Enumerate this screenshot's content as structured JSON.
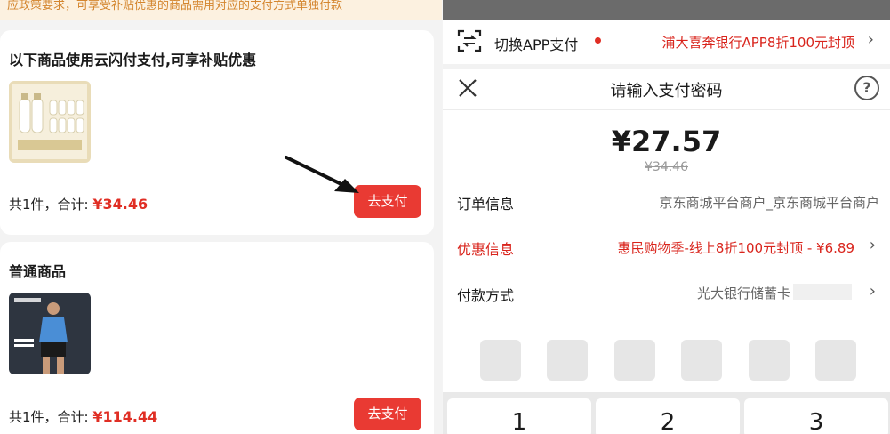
{
  "left": {
    "notice": "应政策要求，可享受补贴优惠的商品需用对应的支付方式单独付款",
    "cards": [
      {
        "title": "以下商品使用云闪付支付,可享补贴优惠",
        "count_label": "共1件，合计: ",
        "amount": "¥34.46",
        "button": "去支付",
        "thumb_icon": "milk-product-image"
      },
      {
        "title": "普通商品",
        "count_label": "共1件，合计: ",
        "amount": "¥114.44",
        "button": "去支付",
        "thumb_icon": "sportswear-product-image"
      }
    ]
  },
  "right": {
    "switch_label": "切换APP支付",
    "promo": "浦大喜奔银行APP8折100元封顶",
    "sheet_title": "请输入支付密码",
    "help": "?",
    "price": "¥27.57",
    "original_price": "¥34.46",
    "rows": [
      {
        "label": "订单信息",
        "value": "京东商城平台商户_京东商城平台商户"
      },
      {
        "label": "优惠信息",
        "value": "惠民购物季-线上8折100元封顶 - ¥6.89"
      },
      {
        "label": "付款方式",
        "value": "光大银行储蓄卡"
      }
    ],
    "keys": [
      "1",
      "2",
      "3"
    ]
  },
  "colors": {
    "accent_red": "#e93a33",
    "promo_red": "#d9241c",
    "notice_bg": "#fcf1e0",
    "notice_text": "#d4862f"
  }
}
